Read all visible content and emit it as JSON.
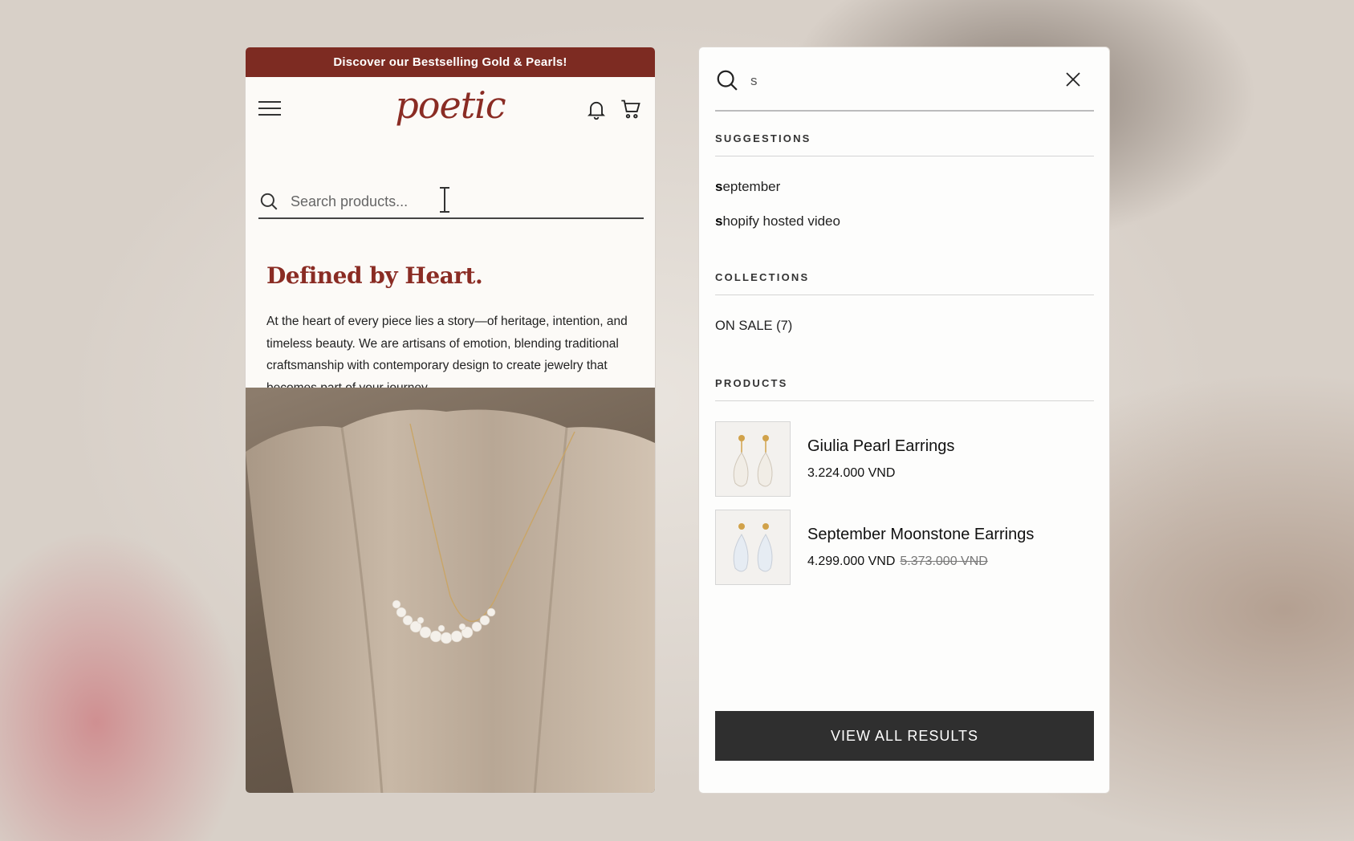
{
  "announcement": "Discover our Bestselling Gold & Pearls!",
  "header": {
    "logo": "poetic",
    "search_placeholder": "Search products..."
  },
  "hero": {
    "title": "Defined by Heart.",
    "text": "At the heart of every piece lies a story—of heritage, intention, and timeless beauty. We are artisans of emotion, blending traditional craftsmanship with contemporary design to create jewelry that becomes part of your journey."
  },
  "search_panel": {
    "query": "s",
    "sections": {
      "suggestions": "SUGGESTIONS",
      "collections": "COLLECTIONS",
      "products": "PRODUCTS"
    },
    "suggestions": [
      {
        "match": "s",
        "rest": "eptember"
      },
      {
        "match": "s",
        "rest": "hopify hosted video"
      }
    ],
    "collections": [
      {
        "label": "ON SALE (7)"
      }
    ],
    "products": [
      {
        "name": "Giulia Pearl Earrings",
        "price": "3.224.000 VND",
        "old_price": ""
      },
      {
        "name": "September Moonstone Earrings",
        "price": "4.299.000 VND",
        "old_price": "5.373.000 VND"
      }
    ],
    "view_all": "VIEW ALL RESULTS"
  },
  "icons": [
    "hamburger-icon",
    "bell-icon",
    "cart-icon",
    "search-icon",
    "close-icon"
  ],
  "colors": {
    "brand": "#7d2b22",
    "button": "#2f2f2f"
  }
}
